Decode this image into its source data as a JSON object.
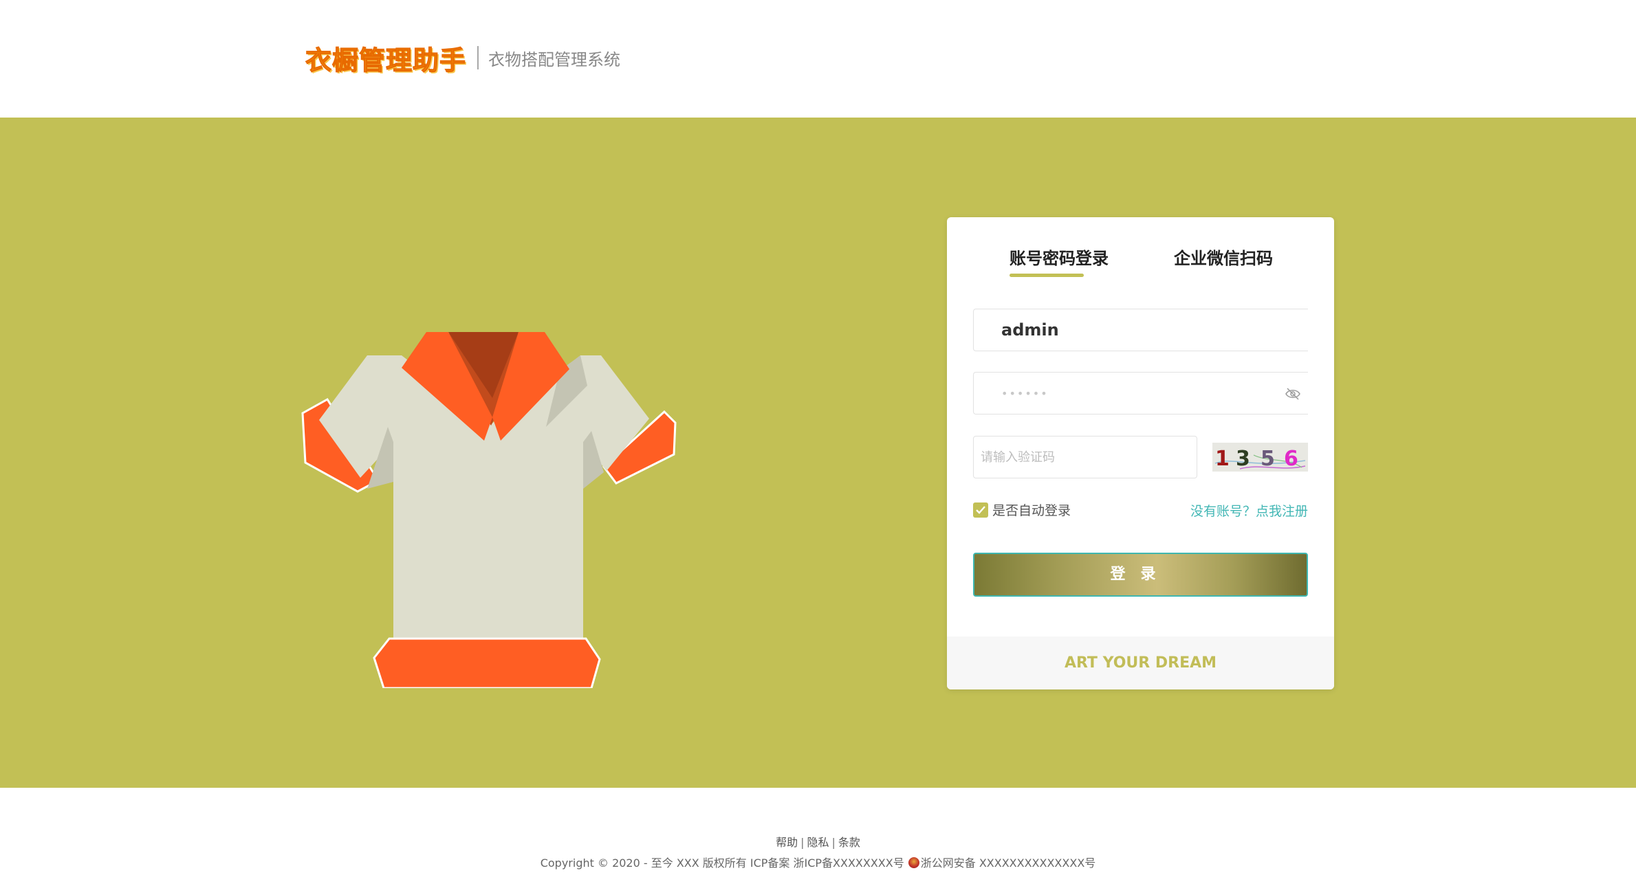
{
  "header": {
    "logo_text": "衣橱管理助手",
    "subtitle": "衣物搭配管理系统"
  },
  "banner": {
    "background_color": "#c2c055",
    "illustration": "t-shirt-illustration"
  },
  "login": {
    "tabs": [
      {
        "label": "账号密码登录",
        "active": true
      },
      {
        "label": "企业微信扫码",
        "active": false
      }
    ],
    "username_value": "admin",
    "password_mask": "••••••",
    "password_toggle_icon": "eye-off-icon",
    "captcha_placeholder": "请输入验证码",
    "captcha_code": "1356",
    "remember_label": "是否自动登录",
    "remember_checked": true,
    "register_link": "没有账号？点我注册",
    "login_button": "登录",
    "footer_slogan": "ART YOUR DREAM",
    "accent_color": "#c2c055",
    "link_color": "#43b7b5"
  },
  "footer": {
    "links": [
      "帮助",
      "隐私",
      "条款"
    ],
    "copyright_text": "Copyright © 2020 - 至今 XXX 版权所有 ICP备案 浙ICP备XXXXXXXX号",
    "police_text": "浙公网安备 XXXXXXXXXXXXXX号"
  }
}
